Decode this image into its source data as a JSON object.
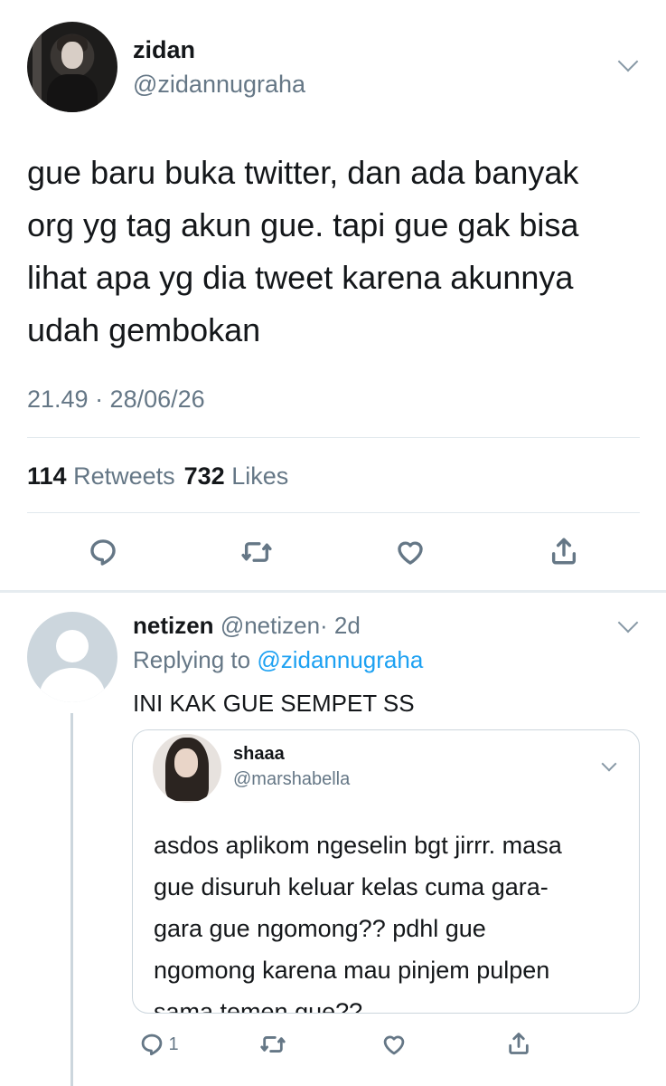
{
  "tweet": {
    "author_name": "zidan",
    "author_handle": "@zidannugraha",
    "text": "gue baru buka twitter, dan ada banyak\norg yg tag akun gue. tapi gue gak bisa\nlihat apa yg dia tweet karena akunnya\nudah gembokan",
    "timestamp": "21.49 · 28/06/26",
    "retweets_count": "114",
    "retweets_label": "Retweets",
    "likes_count": "732",
    "likes_label": "Likes"
  },
  "reply": {
    "author_name": "netizen",
    "author_handle": "@netizen",
    "age": "· 2d",
    "replying_prefix": "Replying to",
    "replying_to": "@zidannugraha",
    "text": "INI KAK GUE SEMPET SS",
    "reply_count": "1",
    "quoted": {
      "author_name": "shaaa",
      "author_handle": "@marshabella",
      "text": "asdos aplikom ngeselin bgt jirrr. masa\ngue disuruh keluar kelas cuma gara-\ngara gue ngomong?? pdhl gue\nngomong karena mau pinjem pulpen\nsama temen gue??"
    }
  },
  "icons": [
    "chevron-down-icon",
    "reply-icon",
    "retweet-icon",
    "like-icon",
    "share-icon"
  ],
  "colors": {
    "text": "#14171a",
    "secondary": "#657786",
    "link": "#1da1f2",
    "divider": "#e1e8ed"
  }
}
